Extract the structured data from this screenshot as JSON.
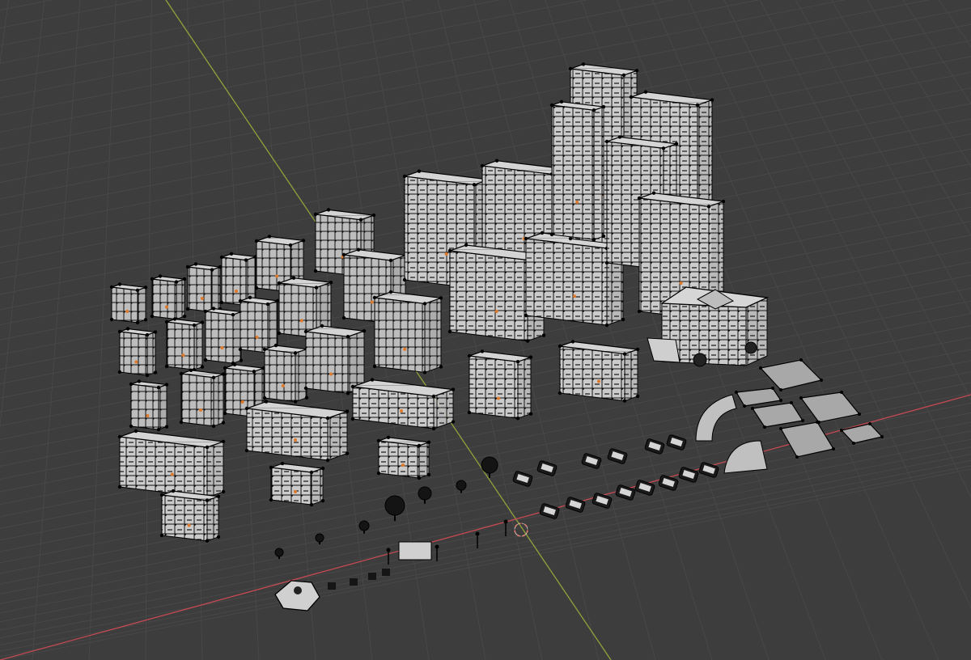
{
  "viewport": {
    "mode": "edit-mode-wireframe-overlay",
    "background_color": "#3d3d3d",
    "grid_color": "#4a4a4a",
    "x_axis_color": "#c54a52",
    "y_axis_color": "#8fa33a",
    "mesh_face_color": "#c9c9c9",
    "mesh_wire_color": "#000000",
    "origin_dot_color": "#e07a2a",
    "cursor_color": "#e08070",
    "grid_visible": true,
    "object_groups": [
      "small-buildings",
      "medium-buildings",
      "tower-buildings",
      "civic-building",
      "road-tiles",
      "vehicles",
      "trees-props",
      "gazebo"
    ],
    "cursor_icon": "3d-cursor-icon"
  }
}
